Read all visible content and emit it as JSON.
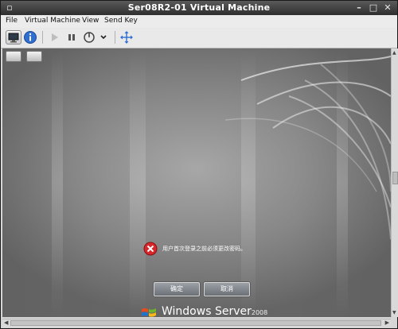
{
  "window": {
    "title": "Ser08R2-01 Virtual Machine"
  },
  "menu": {
    "items": [
      "File",
      "Virtual Machine",
      "View",
      "Send Key"
    ]
  },
  "toolbar": {
    "buttons": [
      "console-icon",
      "info-icon",
      "play-icon",
      "pause-icon",
      "power-icon",
      "dropdown-arrow-icon",
      "fullscreen-icon"
    ]
  },
  "guest": {
    "message": "用户首次登录之前必须更改密码。",
    "ok_label": "确定",
    "cancel_label": "取消",
    "logo_text": "Windows Server",
    "logo_version": "2008",
    "colors": {
      "error": "#d9262b",
      "background": "#8f8f8f"
    }
  }
}
